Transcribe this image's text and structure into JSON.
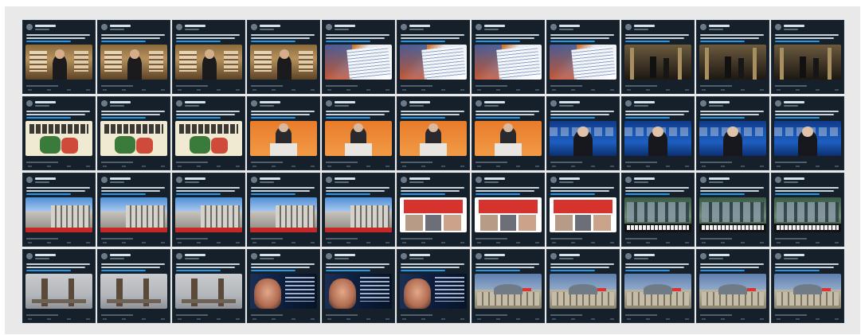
{
  "grid": {
    "columns": 11,
    "rows": [
      {
        "media": "room",
        "count": 4,
        "then": [
          {
            "media": "doc",
            "count": 4
          },
          {
            "media": "hall",
            "count": 3
          }
        ]
      },
      {
        "media": "cartoon",
        "count": 3,
        "then": [
          {
            "media": "podium",
            "count": 4
          },
          {
            "media": "tv",
            "count": 4
          }
        ]
      },
      {
        "media": "build",
        "count": 5,
        "then": [
          {
            "media": "faces",
            "count": 3
          },
          {
            "media": "group",
            "count": 3
          }
        ]
      },
      {
        "media": "tower",
        "count": 3,
        "then": [
          {
            "media": "zel",
            "count": 3
          },
          {
            "media": "reich",
            "count": 5
          }
        ]
      }
    ]
  },
  "colors": {
    "page_bg": "#ffffff",
    "panel_bg": "#e9e9e9",
    "tweet_bg": "#15202b",
    "link_blue": "#1d9bf0"
  },
  "icons": [
    "avatar-icon",
    "reply-icon",
    "retweet-icon",
    "like-icon",
    "share-icon"
  ]
}
